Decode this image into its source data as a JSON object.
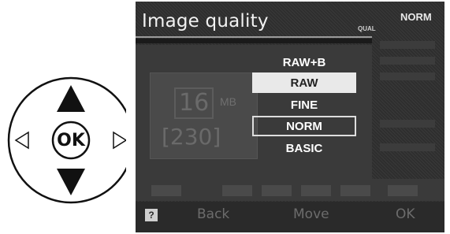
{
  "dial": {
    "center_label": "OK"
  },
  "screen": {
    "title": "Image quality",
    "current_quality": "NORM",
    "qual_tag": "QUAL",
    "file_size": "16",
    "file_size_unit": "MB",
    "shots_remaining": "[230]",
    "options": [
      {
        "label": "RAW+B"
      },
      {
        "label": "RAW"
      },
      {
        "label": "FINE"
      },
      {
        "label": "NORM"
      },
      {
        "label": "BASIC"
      }
    ],
    "help_icon": "?",
    "footer": {
      "back": "Back",
      "move": "Move",
      "ok": "OK"
    }
  }
}
